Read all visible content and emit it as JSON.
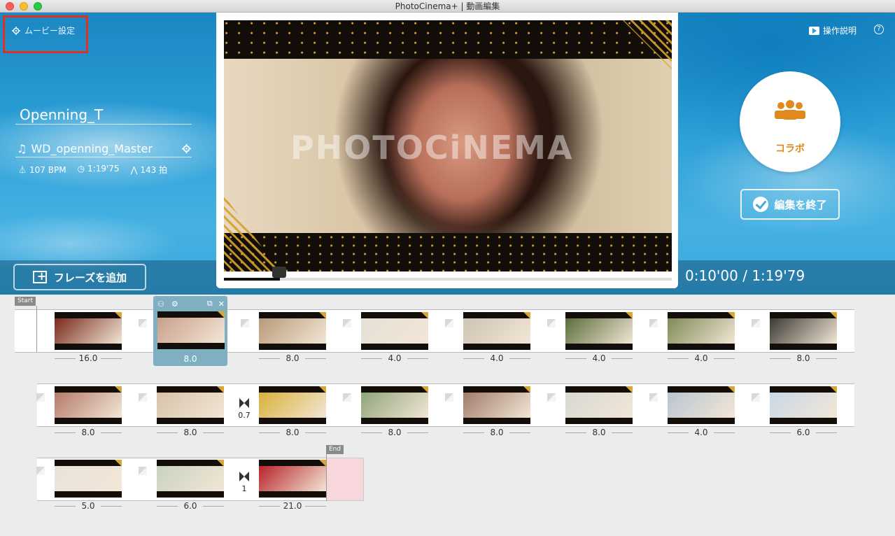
{
  "window": {
    "title": "PhotoCinema+ | 動画編集"
  },
  "header": {
    "movie_settings": "ムービー設定",
    "help_link": "操作説明",
    "help_q": "?"
  },
  "project": {
    "title": "Openning_T",
    "music": "WD_openning_Master",
    "bpm": "107 BPM",
    "duration": "1:19'75",
    "beats": "143 拍"
  },
  "collab": {
    "label": "コラボ"
  },
  "finish_button": "編集を終了",
  "add_phrase_button": "フレーズを追加",
  "timecode": "0:10'00 / 1:19'79",
  "preview": {
    "watermark": "PHOTOCiNEMA",
    "progress": 0.125
  },
  "timeline": {
    "start_label": "Start",
    "end_label": "End",
    "rows": [
      {
        "clips": [
          {
            "duration": "16.0",
            "color": "#7a2a1c",
            "transition": ""
          },
          {
            "duration": "8.0",
            "color": "#c9a08a",
            "transition": "",
            "selected": true
          },
          {
            "duration": "8.0",
            "color": "#b89a78",
            "transition": ""
          },
          {
            "duration": "4.0",
            "color": "#e6e0d6",
            "transition": ""
          },
          {
            "duration": "4.0",
            "color": "#cfc5b4",
            "transition": ""
          },
          {
            "duration": "4.0",
            "color": "#5b6d3a",
            "transition": ""
          },
          {
            "duration": "4.0",
            "color": "#7f8a56",
            "transition": ""
          },
          {
            "duration": "8.0",
            "color": "#3c3a33",
            "transition": ""
          }
        ]
      },
      {
        "clips": [
          {
            "duration": "8.0",
            "color": "#b57a6a",
            "transition": ""
          },
          {
            "duration": "8.0",
            "color": "#d8c2a8",
            "transition": ""
          },
          {
            "duration": "8.0",
            "color": "#d9b13a",
            "transition": "0.7"
          },
          {
            "duration": "8.0",
            "color": "#8fa57a",
            "transition": ""
          },
          {
            "duration": "8.0",
            "color": "#a27c6a",
            "transition": ""
          },
          {
            "duration": "8.0",
            "color": "#d7d9d4",
            "transition": ""
          },
          {
            "duration": "4.0",
            "color": "#b9c5d2",
            "transition": ""
          },
          {
            "duration": "6.0",
            "color": "#c8d9e6",
            "transition": ""
          }
        ]
      },
      {
        "clips": [
          {
            "duration": "5.0",
            "color": "#e9e3dc",
            "transition": ""
          },
          {
            "duration": "6.0",
            "color": "#c9d3bf",
            "transition": ""
          },
          {
            "duration": "21.0",
            "color": "#b8242a",
            "transition": "1"
          }
        ]
      }
    ]
  }
}
